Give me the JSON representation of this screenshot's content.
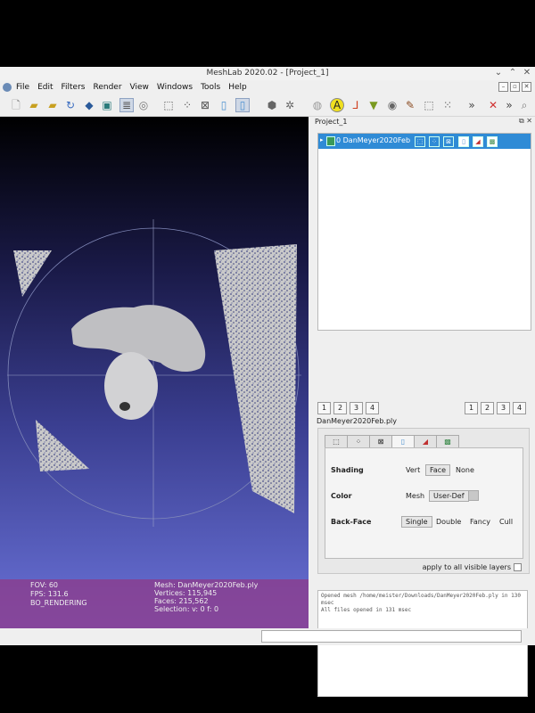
{
  "window": {
    "title": "MeshLab 2020.02 - [Project_1]"
  },
  "menu": [
    "File",
    "Edit",
    "Filters",
    "Render",
    "View",
    "Windows",
    "Tools",
    "Help"
  ],
  "project": {
    "title": "Project_1",
    "layer_name": "0 DanMeyer2020Feb"
  },
  "layer_controls": {
    "left": [
      "1",
      "2",
      "3",
      "4"
    ],
    "right": [
      "1",
      "2",
      "3",
      "4"
    ]
  },
  "mesh_file": "DanMeyer2020Feb.ply",
  "shading": {
    "label": "Shading",
    "options": [
      "Vert",
      "Face",
      "None"
    ],
    "selected": "Face",
    "color_label": "Color",
    "color_options": [
      "Mesh",
      "User-Def"
    ],
    "color_selected": "User-Def",
    "backface_label": "Back-Face",
    "backface_options": [
      "Single",
      "Double",
      "Fancy",
      "Cull"
    ],
    "backface_selected": "Single"
  },
  "apply_all": "apply to all visible layers",
  "log": [
    "Opened mesh /home/meister/Downloads/DanMeyer2020Feb.ply in 130 msec",
    "All files opened in 131 msec"
  ],
  "viewport_info": {
    "fov": "FOV: 60",
    "fps": "FPS:   131.6",
    "mode": "BO_RENDERING",
    "mesh": "Mesh: DanMeyer2020Feb.ply",
    "vertices": "Vertices: 115,945",
    "faces": "Faces: 215,562",
    "selection": "Selection: v: 0 f: 0"
  },
  "colors": {
    "selection": "#2f8bd6",
    "info_bar": "#8c3c8c",
    "bg_top": "#000000",
    "bg_bottom": "#6a72d8"
  },
  "icons": [
    "new-icon",
    "open-icon",
    "open-project-icon",
    "reload-icon",
    "import-icon",
    "snapshot-icon",
    "layers-icon",
    "bbox-icon",
    "points-icon",
    "wireframe-icon",
    "flat-icon",
    "smooth-icon",
    "texture-icon",
    "lighting-icon",
    "annotation-icon",
    "axes-icon",
    "paint-icon",
    "select-icon",
    "measure-icon",
    "pick-icon",
    "close-icon",
    "search-icon"
  ]
}
